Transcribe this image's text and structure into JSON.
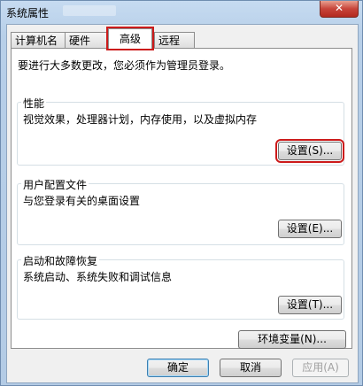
{
  "window": {
    "title": "系统属性",
    "close_glyph": "✕"
  },
  "tabs": [
    {
      "label": "计算机名"
    },
    {
      "label": "硬件"
    },
    {
      "label": "高级",
      "active": true
    },
    {
      "label": "远程"
    }
  ],
  "advanced": {
    "intro": "要进行大多数更改，您必须作为管理员登录。",
    "performance": {
      "title": "性能",
      "desc": "视觉效果，处理器计划，内存使用，以及虚拟内存",
      "button": "设置(S)..."
    },
    "profile": {
      "title": "用户配置文件",
      "desc": "与您登录有关的桌面设置",
      "button": "设置(E)..."
    },
    "startup": {
      "title": "启动和故障恢复",
      "desc": "系统启动、系统失败和调试信息",
      "button": "设置(T)..."
    },
    "env_button": "环境变量(N)..."
  },
  "footer": {
    "ok": "确定",
    "cancel": "取消",
    "apply": "应用(A)"
  },
  "colors": {
    "highlight": "#cc1a1a",
    "window_frame": "#b3cbe5"
  }
}
